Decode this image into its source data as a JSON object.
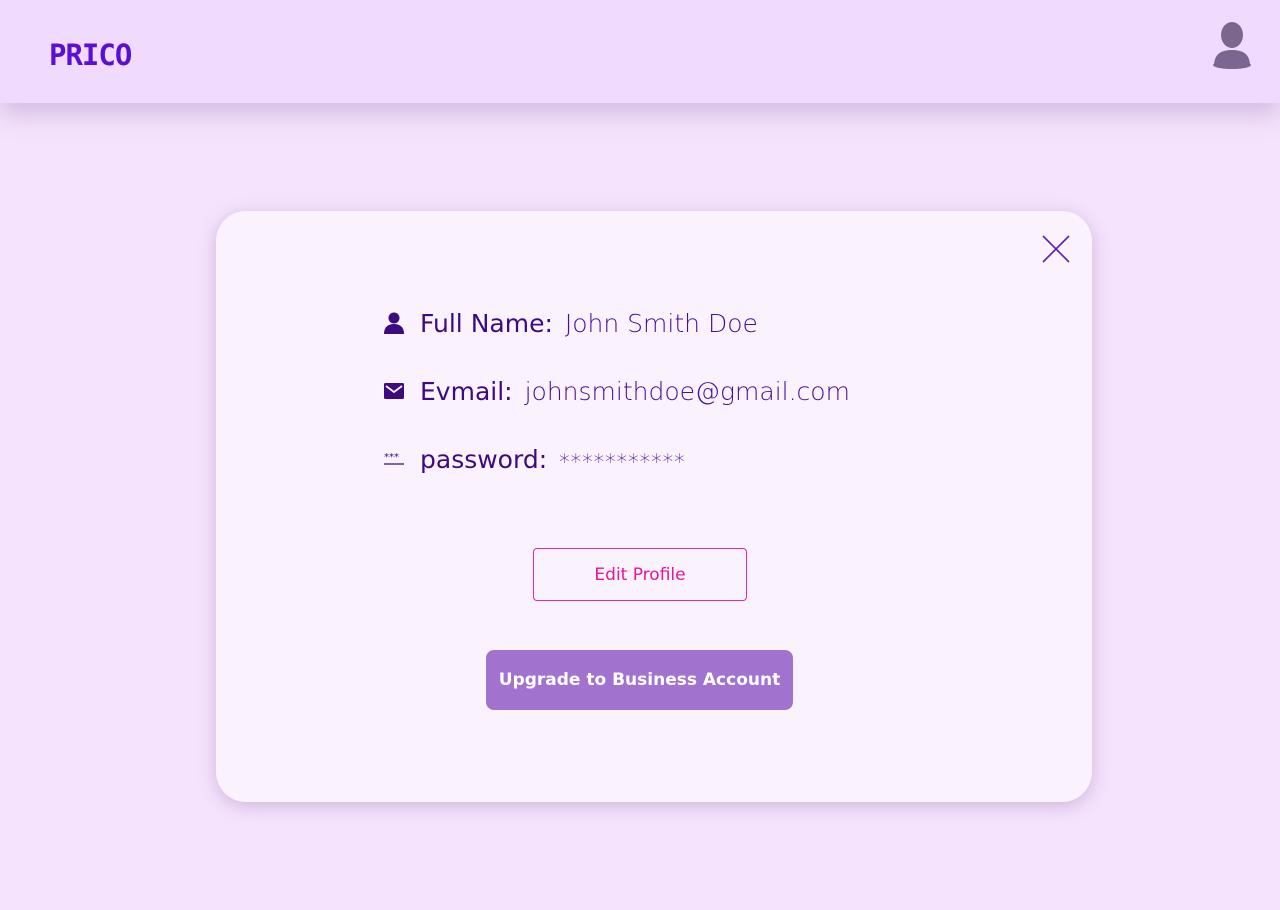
{
  "header": {
    "logo_text": "PRICO",
    "avatar_icon": "user-avatar-icon"
  },
  "profile": {
    "close_icon": "close-icon",
    "full_name": {
      "icon": "user-icon",
      "label": "Full Name:",
      "value": "John Smith Doe"
    },
    "email": {
      "icon": "mail-icon",
      "label": "Evmail:",
      "value": "johnsmithdoe@gmail.com"
    },
    "password": {
      "icon": "password-dots-icon",
      "label": "password:",
      "value": "***********"
    },
    "edit_button": "Edit Profile",
    "upgrade_button": "Upgrade to Business Account"
  },
  "colors": {
    "background": "#f5e3fd",
    "header": "#f0dafe",
    "card": "#faf2fd",
    "brand": "#5a0fd4",
    "text": "#3d0a80",
    "edit_accent": "#e4169b",
    "upgrade_bg": "#a273ce"
  }
}
